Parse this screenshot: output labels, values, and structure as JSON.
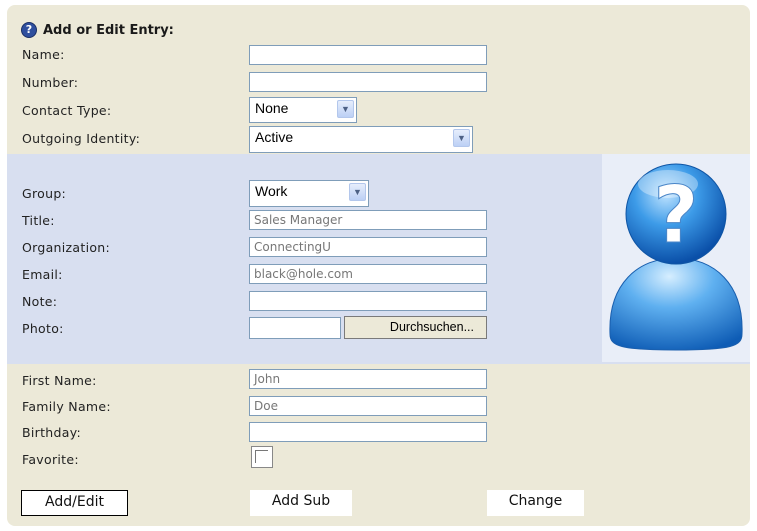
{
  "form": {
    "heading": "Add or Edit Entry:",
    "help_icon": "?"
  },
  "labels": {
    "name": "Name:",
    "number": "Number:",
    "contact_type": "Contact Type:",
    "outgoing_identity": "Outgoing Identity:",
    "group": "Group:",
    "title": "Title:",
    "organization": "Organization:",
    "email": "Email:",
    "note": "Note:",
    "photo": "Photo:",
    "first_name": "First Name:",
    "family_name": "Family Name:",
    "birthday": "Birthday:",
    "favorite": "Favorite:"
  },
  "fields": {
    "name": "",
    "number": "",
    "contact_type": "None",
    "outgoing_identity": "Active",
    "group": "Work",
    "title": "Sales Manager",
    "organization": "ConnectingU",
    "email": "black@hole.com",
    "note": "",
    "photo": "",
    "first_name": "John",
    "family_name": "Doe",
    "birthday": "",
    "favorite": false
  },
  "buttons": {
    "browse": "Durchsuchen...",
    "add_edit": "Add/Edit",
    "add_sub": "Add Sub",
    "change": "Change"
  },
  "icons": {
    "help": "help-question-icon",
    "avatar": "unknown-user-avatar",
    "dropdown": "chevron-down-icon"
  },
  "colors": {
    "panel_bg": "#ece9d8",
    "section_bg": "#d8dff0",
    "input_border": "#7f9db9"
  }
}
